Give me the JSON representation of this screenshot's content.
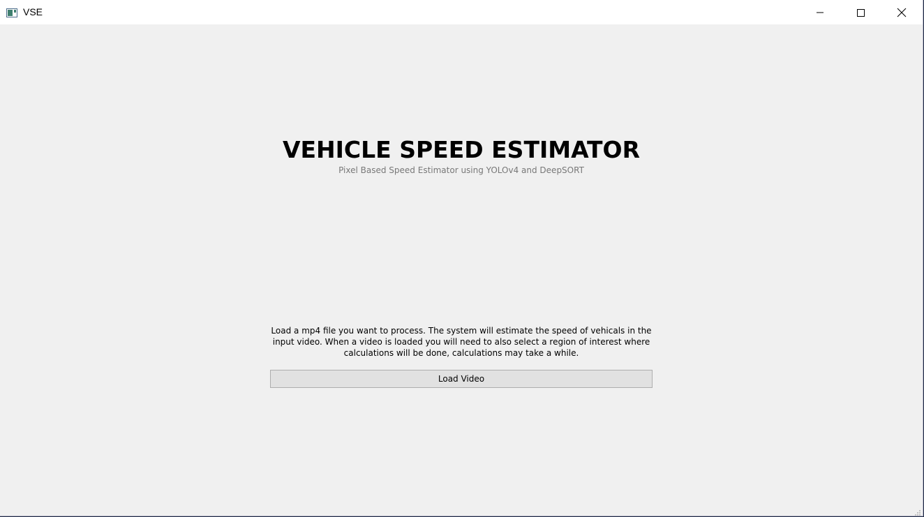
{
  "window": {
    "title": "VSE",
    "icon": "app-window-icon",
    "controls": {
      "minimize": "minimize-icon",
      "maximize": "maximize-icon",
      "close": "close-icon"
    }
  },
  "main": {
    "heading": "VEHICLE SPEED ESTIMATOR",
    "subheading": "Pixel Based Speed Estimator using YOLOv4 and DeepSORT",
    "instructions": "Load a mp4 file you want to process. The system will estimate the speed of vehicals in the input video. When a video is loaded you will need to also select a region of interest where calculations will be done, calculations may take a while.",
    "load_button_label": "Load Video"
  },
  "colors": {
    "background": "#f0f0f0",
    "titlebar": "#ffffff",
    "subheading_text": "#787878",
    "button_face": "#e1e1e1",
    "button_border": "#adadad"
  }
}
